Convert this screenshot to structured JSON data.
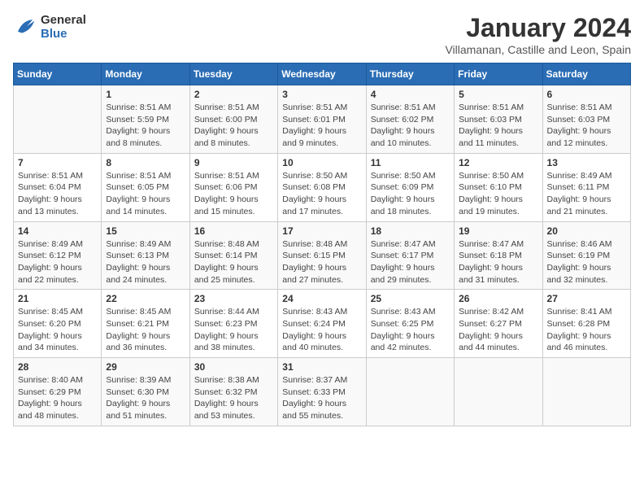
{
  "logo": {
    "line1": "General",
    "line2": "Blue"
  },
  "title": "January 2024",
  "subtitle": "Villamanan, Castille and Leon, Spain",
  "days_of_week": [
    "Sunday",
    "Monday",
    "Tuesday",
    "Wednesday",
    "Thursday",
    "Friday",
    "Saturday"
  ],
  "weeks": [
    [
      {
        "day": "",
        "sunrise": "",
        "sunset": "",
        "daylight": ""
      },
      {
        "day": "1",
        "sunrise": "Sunrise: 8:51 AM",
        "sunset": "Sunset: 5:59 PM",
        "daylight": "Daylight: 9 hours and 8 minutes."
      },
      {
        "day": "2",
        "sunrise": "Sunrise: 8:51 AM",
        "sunset": "Sunset: 6:00 PM",
        "daylight": "Daylight: 9 hours and 8 minutes."
      },
      {
        "day": "3",
        "sunrise": "Sunrise: 8:51 AM",
        "sunset": "Sunset: 6:01 PM",
        "daylight": "Daylight: 9 hours and 9 minutes."
      },
      {
        "day": "4",
        "sunrise": "Sunrise: 8:51 AM",
        "sunset": "Sunset: 6:02 PM",
        "daylight": "Daylight: 9 hours and 10 minutes."
      },
      {
        "day": "5",
        "sunrise": "Sunrise: 8:51 AM",
        "sunset": "Sunset: 6:03 PM",
        "daylight": "Daylight: 9 hours and 11 minutes."
      },
      {
        "day": "6",
        "sunrise": "Sunrise: 8:51 AM",
        "sunset": "Sunset: 6:03 PM",
        "daylight": "Daylight: 9 hours and 12 minutes."
      }
    ],
    [
      {
        "day": "7",
        "sunrise": "Sunrise: 8:51 AM",
        "sunset": "Sunset: 6:04 PM",
        "daylight": "Daylight: 9 hours and 13 minutes."
      },
      {
        "day": "8",
        "sunrise": "Sunrise: 8:51 AM",
        "sunset": "Sunset: 6:05 PM",
        "daylight": "Daylight: 9 hours and 14 minutes."
      },
      {
        "day": "9",
        "sunrise": "Sunrise: 8:51 AM",
        "sunset": "Sunset: 6:06 PM",
        "daylight": "Daylight: 9 hours and 15 minutes."
      },
      {
        "day": "10",
        "sunrise": "Sunrise: 8:50 AM",
        "sunset": "Sunset: 6:08 PM",
        "daylight": "Daylight: 9 hours and 17 minutes."
      },
      {
        "day": "11",
        "sunrise": "Sunrise: 8:50 AM",
        "sunset": "Sunset: 6:09 PM",
        "daylight": "Daylight: 9 hours and 18 minutes."
      },
      {
        "day": "12",
        "sunrise": "Sunrise: 8:50 AM",
        "sunset": "Sunset: 6:10 PM",
        "daylight": "Daylight: 9 hours and 19 minutes."
      },
      {
        "day": "13",
        "sunrise": "Sunrise: 8:49 AM",
        "sunset": "Sunset: 6:11 PM",
        "daylight": "Daylight: 9 hours and 21 minutes."
      }
    ],
    [
      {
        "day": "14",
        "sunrise": "Sunrise: 8:49 AM",
        "sunset": "Sunset: 6:12 PM",
        "daylight": "Daylight: 9 hours and 22 minutes."
      },
      {
        "day": "15",
        "sunrise": "Sunrise: 8:49 AM",
        "sunset": "Sunset: 6:13 PM",
        "daylight": "Daylight: 9 hours and 24 minutes."
      },
      {
        "day": "16",
        "sunrise": "Sunrise: 8:48 AM",
        "sunset": "Sunset: 6:14 PM",
        "daylight": "Daylight: 9 hours and 25 minutes."
      },
      {
        "day": "17",
        "sunrise": "Sunrise: 8:48 AM",
        "sunset": "Sunset: 6:15 PM",
        "daylight": "Daylight: 9 hours and 27 minutes."
      },
      {
        "day": "18",
        "sunrise": "Sunrise: 8:47 AM",
        "sunset": "Sunset: 6:17 PM",
        "daylight": "Daylight: 9 hours and 29 minutes."
      },
      {
        "day": "19",
        "sunrise": "Sunrise: 8:47 AM",
        "sunset": "Sunset: 6:18 PM",
        "daylight": "Daylight: 9 hours and 31 minutes."
      },
      {
        "day": "20",
        "sunrise": "Sunrise: 8:46 AM",
        "sunset": "Sunset: 6:19 PM",
        "daylight": "Daylight: 9 hours and 32 minutes."
      }
    ],
    [
      {
        "day": "21",
        "sunrise": "Sunrise: 8:45 AM",
        "sunset": "Sunset: 6:20 PM",
        "daylight": "Daylight: 9 hours and 34 minutes."
      },
      {
        "day": "22",
        "sunrise": "Sunrise: 8:45 AM",
        "sunset": "Sunset: 6:21 PM",
        "daylight": "Daylight: 9 hours and 36 minutes."
      },
      {
        "day": "23",
        "sunrise": "Sunrise: 8:44 AM",
        "sunset": "Sunset: 6:23 PM",
        "daylight": "Daylight: 9 hours and 38 minutes."
      },
      {
        "day": "24",
        "sunrise": "Sunrise: 8:43 AM",
        "sunset": "Sunset: 6:24 PM",
        "daylight": "Daylight: 9 hours and 40 minutes."
      },
      {
        "day": "25",
        "sunrise": "Sunrise: 8:43 AM",
        "sunset": "Sunset: 6:25 PM",
        "daylight": "Daylight: 9 hours and 42 minutes."
      },
      {
        "day": "26",
        "sunrise": "Sunrise: 8:42 AM",
        "sunset": "Sunset: 6:27 PM",
        "daylight": "Daylight: 9 hours and 44 minutes."
      },
      {
        "day": "27",
        "sunrise": "Sunrise: 8:41 AM",
        "sunset": "Sunset: 6:28 PM",
        "daylight": "Daylight: 9 hours and 46 minutes."
      }
    ],
    [
      {
        "day": "28",
        "sunrise": "Sunrise: 8:40 AM",
        "sunset": "Sunset: 6:29 PM",
        "daylight": "Daylight: 9 hours and 48 minutes."
      },
      {
        "day": "29",
        "sunrise": "Sunrise: 8:39 AM",
        "sunset": "Sunset: 6:30 PM",
        "daylight": "Daylight: 9 hours and 51 minutes."
      },
      {
        "day": "30",
        "sunrise": "Sunrise: 8:38 AM",
        "sunset": "Sunset: 6:32 PM",
        "daylight": "Daylight: 9 hours and 53 minutes."
      },
      {
        "day": "31",
        "sunrise": "Sunrise: 8:37 AM",
        "sunset": "Sunset: 6:33 PM",
        "daylight": "Daylight: 9 hours and 55 minutes."
      },
      {
        "day": "",
        "sunrise": "",
        "sunset": "",
        "daylight": ""
      },
      {
        "day": "",
        "sunrise": "",
        "sunset": "",
        "daylight": ""
      },
      {
        "day": "",
        "sunrise": "",
        "sunset": "",
        "daylight": ""
      }
    ]
  ]
}
